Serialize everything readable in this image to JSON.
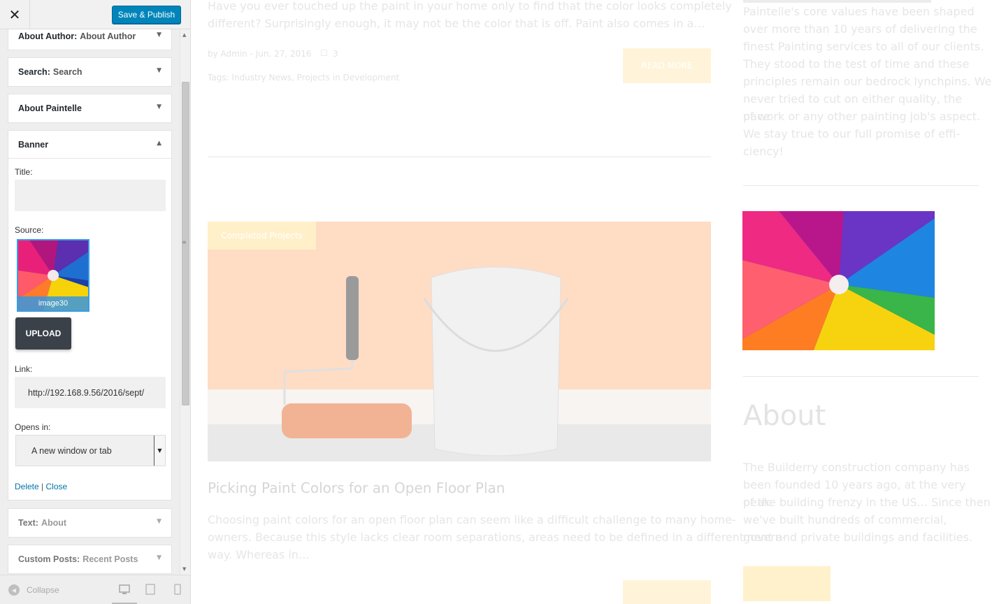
{
  "customizer": {
    "close_icon": "close-icon",
    "save_label": "Save & Publish",
    "widgets": [
      {
        "type": "About Author:",
        "title": "About Author"
      },
      {
        "type": "Search:",
        "title": "Search"
      },
      {
        "type": "About Paintelle",
        "title": ""
      },
      {
        "type": "Banner",
        "title": ""
      },
      {
        "type": "Text:",
        "title": "About"
      },
      {
        "type": "Custom Posts:",
        "title": "Recent Posts"
      }
    ],
    "banner": {
      "title_label": "Title:",
      "title_value": "",
      "source_label": "Source:",
      "image_name": "image30",
      "upload_label": "UPLOAD",
      "link_label": "Link:",
      "link_value": "http://192.168.9.56/2016/sept/",
      "opens_label": "Opens in:",
      "opens_value": "A new window or tab",
      "delete_label": "Delete",
      "separator": "|",
      "close_label": "Close"
    },
    "footer": {
      "collapse_label": "Collapse"
    }
  },
  "preview": {
    "post1_excerpt_line1": "Have you ever touched up the paint in your home only to find that the color looks completely",
    "post1_excerpt_line2": "different? Surprisingly enough, it may not be the color that is off. Paint also comes in a…",
    "post1_meta": "by Admin - Jun. 27, 2016",
    "post1_comments": "3",
    "post1_tags": "Tags: Industry News, Projects in Development",
    "read_more": "READ MORE",
    "post2_badge": "Completed Projects",
    "post2_title": "Picking Paint Colors for an Open Floor Plan",
    "post2_excerpt_line1": "Choosing paint colors for an open floor plan can seem like a difficult challenge to many home-",
    "post2_excerpt_line2": "owners. Because this style lacks clear room separations, areas need to be defined in a different",
    "post2_excerpt_line3": "way. Whereas in…",
    "side_text": [
      "Paintelle's core values have been shaped",
      "over more than 10 years of delivering the",
      "finest Painting services to all of our clients.",
      "They stood to the test of time and these",
      "principles remain our bedrock lynchpins. We",
      "never tried to cut on either quality, the pace",
      "of work or any other painting job's aspect.",
      "We stay true to our full promise of effi-",
      "ciency!"
    ],
    "about_heading": "About",
    "about_text": [
      "The Builderry construction company has",
      "been founded 10 years ago, at the very peak",
      "of the building frenzy in the US... Since then",
      "we've built hundreds of commercial, govern-",
      "ment and private buildings and facilities."
    ]
  }
}
